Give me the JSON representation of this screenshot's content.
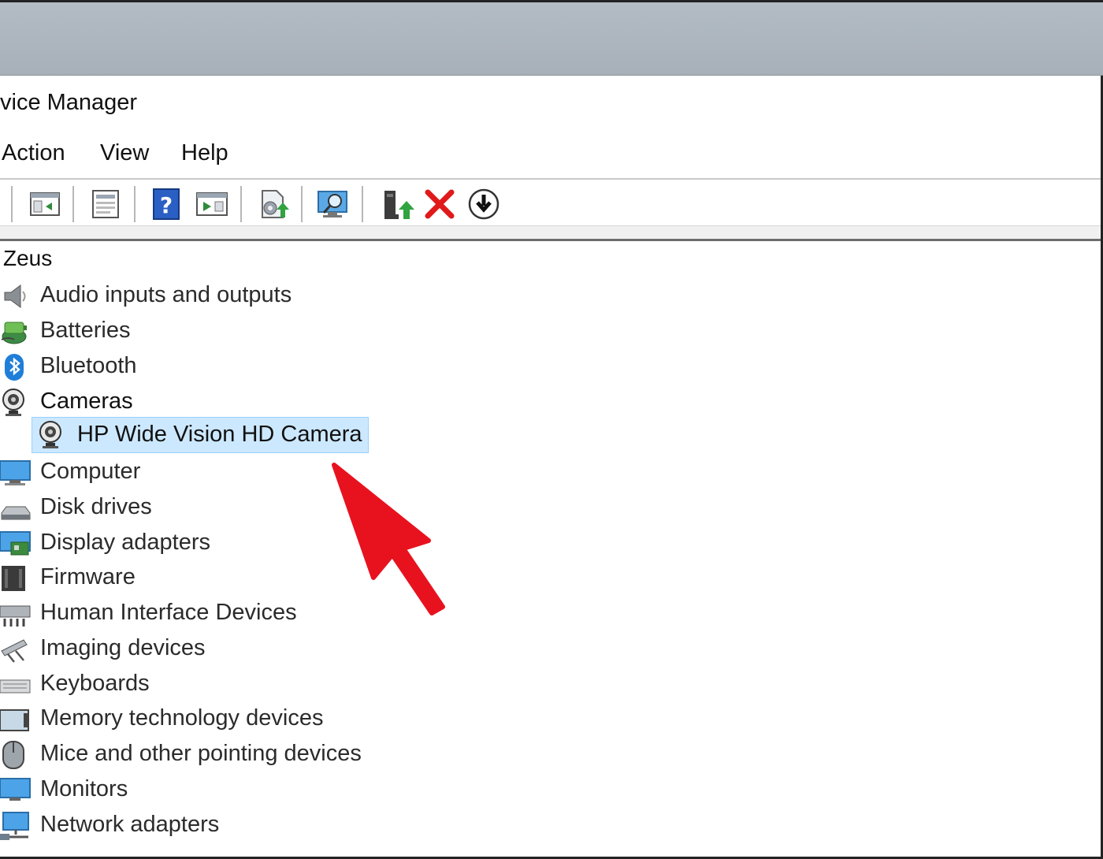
{
  "window": {
    "title": "vice Manager"
  },
  "menu": {
    "items": [
      "Action",
      "View",
      "Help"
    ]
  },
  "toolbar": {
    "icons": [
      "properties-icon",
      "refresh-view-icon",
      "help-icon",
      "run-icon",
      "update-driver-icon",
      "scan-hardware-icon",
      "enable-device-icon",
      "uninstall-device-icon",
      "download-icon"
    ]
  },
  "tree": {
    "root": "Zeus",
    "categories": [
      {
        "label": "Audio inputs and outputs",
        "icon": "speaker-icon"
      },
      {
        "label": "Batteries",
        "icon": "battery-icon"
      },
      {
        "label": "Bluetooth",
        "icon": "bluetooth-icon"
      },
      {
        "label": "Cameras",
        "icon": "camera-icon"
      },
      {
        "label": "Computer",
        "icon": "computer-icon"
      },
      {
        "label": "Disk drives",
        "icon": "disk-drive-icon"
      },
      {
        "label": "Display adapters",
        "icon": "display-adapter-icon"
      },
      {
        "label": "Firmware",
        "icon": "firmware-icon"
      },
      {
        "label": "Human Interface Devices",
        "icon": "hid-icon"
      },
      {
        "label": "Imaging devices",
        "icon": "imaging-icon"
      },
      {
        "label": "Keyboards",
        "icon": "keyboard-icon"
      },
      {
        "label": "Memory technology devices",
        "icon": "memory-icon"
      },
      {
        "label": "Mice and other pointing devices",
        "icon": "mouse-icon"
      },
      {
        "label": "Monitors",
        "icon": "monitor-icon"
      },
      {
        "label": "Network adapters",
        "icon": "network-icon"
      }
    ],
    "selected_child": {
      "label": "HP Wide Vision HD Camera",
      "icon": "camera-icon"
    }
  },
  "colors": {
    "selection": "#cce8ff",
    "selection_border": "#99d1ff",
    "arrow": "#e8121f"
  }
}
